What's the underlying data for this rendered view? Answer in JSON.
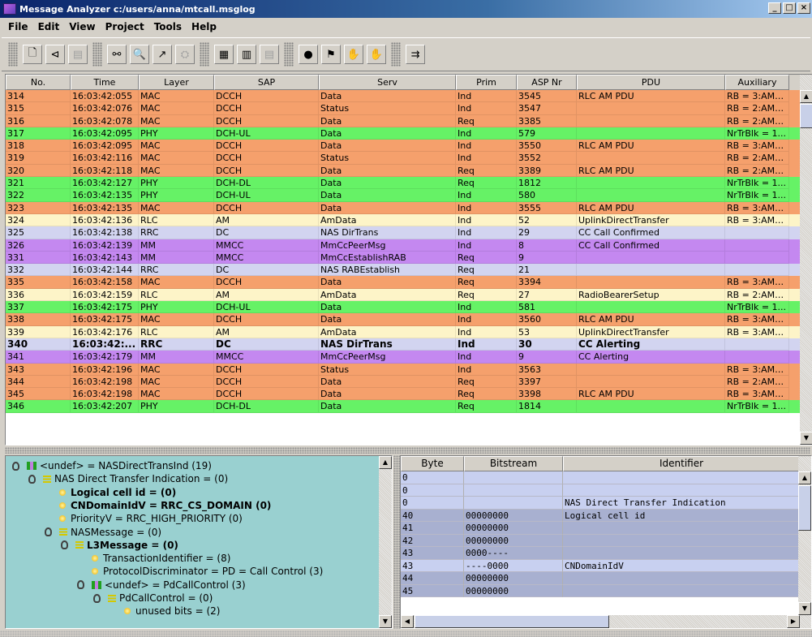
{
  "window": {
    "title": "Message Analyzer c:/users/anna/mtcall.msglog"
  },
  "menu": [
    "File",
    "Edit",
    "View",
    "Project",
    "Tools",
    "Help"
  ],
  "colors": {
    "MAC": "#f5a06c",
    "PHY": "#66f266",
    "RLC": "#fdf4c8",
    "RRC": "#d2d4f0",
    "MM": "#c488f0",
    "tree_bg": "#99d0d0"
  },
  "table": {
    "columns": [
      "No.",
      "Time",
      "Layer",
      "SAP",
      "Serv",
      "Prim",
      "ASP Nr",
      "PDU",
      "Auxiliary"
    ],
    "rows": [
      [
        "314",
        "16:03:42:055",
        "MAC",
        "DCCH",
        "Data",
        "Ind",
        "3545",
        "RLC AM PDU",
        "RB = 3:AM+..."
      ],
      [
        "315",
        "16:03:42:076",
        "MAC",
        "DCCH",
        "Status",
        "Ind",
        "3547",
        "",
        "RB = 2:AM+..."
      ],
      [
        "316",
        "16:03:42:078",
        "MAC",
        "DCCH",
        "Data",
        "Req",
        "3385",
        "",
        "RB = 2:AM+..."
      ],
      [
        "317",
        "16:03:42:095",
        "PHY",
        "DCH-UL",
        "Data",
        "Ind",
        "579",
        "",
        "NrTrBlk = 1..."
      ],
      [
        "318",
        "16:03:42:095",
        "MAC",
        "DCCH",
        "Data",
        "Ind",
        "3550",
        "RLC AM PDU",
        "RB = 3:AM+..."
      ],
      [
        "319",
        "16:03:42:116",
        "MAC",
        "DCCH",
        "Status",
        "Ind",
        "3552",
        "",
        "RB = 2:AM+..."
      ],
      [
        "320",
        "16:03:42:118",
        "MAC",
        "DCCH",
        "Data",
        "Req",
        "3389",
        "RLC AM PDU",
        "RB = 2:AM+..."
      ],
      [
        "321",
        "16:03:42:127",
        "PHY",
        "DCH-DL",
        "Data",
        "Req",
        "1812",
        "",
        "NrTrBlk = 1..."
      ],
      [
        "322",
        "16:03:42:135",
        "PHY",
        "DCH-UL",
        "Data",
        "Ind",
        "580",
        "",
        "NrTrBlk = 1..."
      ],
      [
        "323",
        "16:03:42:135",
        "MAC",
        "DCCH",
        "Data",
        "Ind",
        "3555",
        "RLC AM PDU",
        "RB = 3:AM+..."
      ],
      [
        "324",
        "16:03:42:136",
        "RLC",
        "AM",
        "AmData",
        "Ind",
        "52",
        "UplinkDirectTransfer",
        "RB = 3:AM+..."
      ],
      [
        "325",
        "16:03:42:138",
        "RRC",
        "DC",
        "NAS DirTrans",
        "Ind",
        "29",
        "CC Call Confirmed",
        ""
      ],
      [
        "326",
        "16:03:42:139",
        "MM",
        "MMCC",
        "MmCcPeerMsg",
        "Ind",
        "8",
        "CC Call Confirmed",
        ""
      ],
      [
        "331",
        "16:03:42:143",
        "MM",
        "MMCC",
        "MmCcEstablishRAB",
        "Req",
        "9",
        "",
        ""
      ],
      [
        "332",
        "16:03:42:144",
        "RRC",
        "DC",
        "NAS RABEstablish",
        "Req",
        "21",
        "",
        ""
      ],
      [
        "335",
        "16:03:42:158",
        "MAC",
        "DCCH",
        "Data",
        "Req",
        "3394",
        "",
        "RB = 3:AM+..."
      ],
      [
        "336",
        "16:03:42:159",
        "RLC",
        "AM",
        "AmData",
        "Req",
        "27",
        "RadioBearerSetup",
        "RB = 2:AM+..."
      ],
      [
        "337",
        "16:03:42:175",
        "PHY",
        "DCH-UL",
        "Data",
        "Ind",
        "581",
        "",
        "NrTrBlk = 1..."
      ],
      [
        "338",
        "16:03:42:175",
        "MAC",
        "DCCH",
        "Data",
        "Ind",
        "3560",
        "RLC AM PDU",
        "RB = 3:AM+..."
      ],
      [
        "339",
        "16:03:42:176",
        "RLC",
        "AM",
        "AmData",
        "Ind",
        "53",
        "UplinkDirectTransfer",
        "RB = 3:AM+..."
      ],
      [
        "340",
        "16:03:42:...",
        "RRC",
        "DC",
        "NAS DirTrans",
        "Ind",
        "30",
        "CC Alerting",
        ""
      ],
      [
        "341",
        "16:03:42:179",
        "MM",
        "MMCC",
        "MmCcPeerMsg",
        "Ind",
        "9",
        "CC Alerting",
        ""
      ],
      [
        "343",
        "16:03:42:196",
        "MAC",
        "DCCH",
        "Status",
        "Ind",
        "3563",
        "",
        "RB = 3:AM+..."
      ],
      [
        "344",
        "16:03:42:198",
        "MAC",
        "DCCH",
        "Data",
        "Req",
        "3397",
        "",
        "RB = 2:AM+..."
      ],
      [
        "345",
        "16:03:42:198",
        "MAC",
        "DCCH",
        "Data",
        "Req",
        "3398",
        "RLC AM PDU",
        "RB = 3:AM+..."
      ],
      [
        "346",
        "16:03:42:207",
        "PHY",
        "DCH-DL",
        "Data",
        "Req",
        "1814",
        "",
        "NrTrBlk = 1..."
      ]
    ],
    "selected_row": "340"
  },
  "tree": [
    {
      "label": "<undef> = NASDirectTransInd (19)",
      "icon": "grid-icon",
      "expanded": true,
      "level": 0
    },
    {
      "label": "NAS Direct Transfer Indication = (0)",
      "icon": "list-icon",
      "expanded": true,
      "level": 1
    },
    {
      "label": "Logical cell id = (0)",
      "icon": "leaf-dot-icon",
      "bold": true,
      "level": 2
    },
    {
      "label": "CNDomainIdV = RRC_CS_DOMAIN (0)",
      "icon": "leaf-dot-icon",
      "bold": true,
      "level": 2
    },
    {
      "label": "PriorityV = RRC_HIGH_PRIORITY (0)",
      "icon": "leaf-dot-icon",
      "level": 2
    },
    {
      "label": "NASMessage = (0)",
      "icon": "list-icon",
      "expanded": true,
      "level": 2
    },
    {
      "label": "L3Message = (0)",
      "icon": "list-icon",
      "expanded": true,
      "bold": true,
      "level": 3
    },
    {
      "label": "TransactionIdentifier = (8)",
      "icon": "leaf-dot-icon",
      "level": 4
    },
    {
      "label": "ProtocolDiscriminator = PD = Call Control (3)",
      "icon": "leaf-dot-icon",
      "level": 4
    },
    {
      "label": "<undef> = PdCallControl (3)",
      "icon": "grid-icon",
      "expanded": true,
      "level": 4
    },
    {
      "label": "PdCallControl = (0)",
      "icon": "list-icon",
      "expanded": true,
      "level": 5
    },
    {
      "label": "unused bits = (2)",
      "icon": "leaf-dot-icon",
      "level": 6
    }
  ],
  "hex": {
    "columns": [
      "Byte",
      "Bitstream",
      "Identifier"
    ],
    "rows": [
      [
        "0",
        "",
        ""
      ],
      [
        "0",
        "",
        ""
      ],
      [
        "0",
        "",
        "NAS Direct Transfer Indication"
      ],
      [
        "40",
        "00000000",
        "Logical cell id"
      ],
      [
        "41",
        "00000000",
        ""
      ],
      [
        "42",
        "00000000",
        ""
      ],
      [
        "43",
        "0000----",
        ""
      ],
      [
        "43",
        "----0000",
        "CNDomainIdV"
      ],
      [
        "44",
        "00000000",
        ""
      ],
      [
        "45",
        "00000000",
        ""
      ]
    ]
  },
  "toolbar": [
    {
      "icon": "new-file-icon",
      "glyph": "🗋"
    },
    {
      "icon": "open-icon",
      "glyph": "⊲"
    },
    {
      "icon": "save-icon",
      "glyph": "▤",
      "disabled": true
    },
    {
      "icon": "find-icon",
      "glyph": "⚯"
    },
    {
      "icon": "search-icon",
      "glyph": "🔍"
    },
    {
      "icon": "arrow-icon",
      "glyph": "↗"
    },
    {
      "icon": "filter-icon",
      "glyph": "⛭",
      "disabled": true
    },
    {
      "icon": "grid-view-icon",
      "glyph": "▦"
    },
    {
      "icon": "table-view-icon",
      "glyph": "▥"
    },
    {
      "icon": "list-view-icon",
      "glyph": "▤",
      "disabled": true
    },
    {
      "icon": "drop-icon",
      "glyph": "●"
    },
    {
      "icon": "pdu-icon",
      "glyph": "⚑"
    },
    {
      "icon": "hand-icon",
      "glyph": "✋"
    },
    {
      "icon": "hand-gray-icon",
      "glyph": "✋",
      "disabled": true
    },
    {
      "icon": "export-icon",
      "glyph": "⇉"
    }
  ]
}
